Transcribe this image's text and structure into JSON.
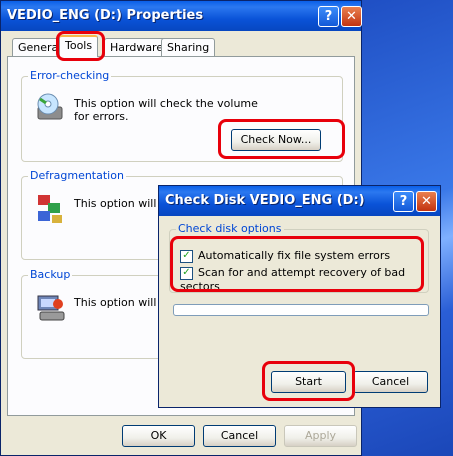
{
  "props_window": {
    "title": "VEDIO_ENG (D:) Properties",
    "help_glyph": "?",
    "close_glyph": "✕",
    "tabs": [
      {
        "label": "General"
      },
      {
        "label": "Tools"
      },
      {
        "label": "Hardware"
      },
      {
        "label": "Sharing"
      }
    ],
    "error_checking": {
      "title": "Error-checking",
      "text": "This option will check the volume for errors.",
      "button": "Check Now..."
    },
    "defrag": {
      "title": "Defragmentation",
      "text": "This option will de"
    },
    "backup": {
      "title": "Backup",
      "text": "This option will ba"
    },
    "footer": {
      "ok": "OK",
      "cancel": "Cancel",
      "apply": "Apply"
    }
  },
  "check_disk": {
    "title": "Check Disk VEDIO_ENG (D:)",
    "help_glyph": "?",
    "close_glyph": "✕",
    "options_title": "Check disk options",
    "option1": "Automatically fix file system errors",
    "option2": "Scan for and attempt recovery of bad sectors",
    "checkmark": "✓",
    "progress": 0,
    "start": "Start",
    "cancel": "Cancel"
  },
  "colors": {
    "highlight": "#e8000b",
    "title_blue": "#0a53d8",
    "group_title": "#0046d5"
  }
}
